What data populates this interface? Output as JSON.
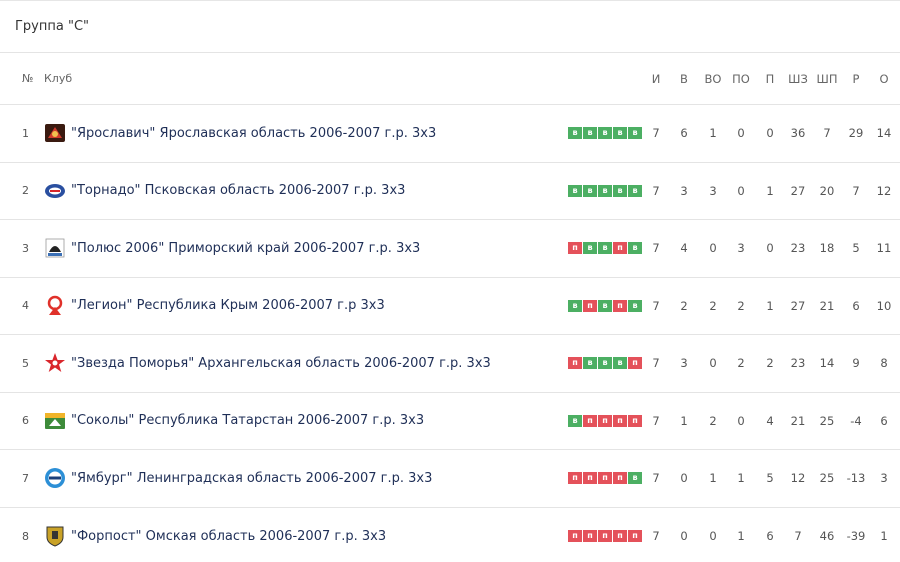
{
  "group_title": "Группа \"С\"",
  "headers": {
    "num": "№",
    "club": "Клуб",
    "i": "И",
    "v": "В",
    "vo": "ВО",
    "po": "ПО",
    "p": "П",
    "sz": "ШЗ",
    "sp": "ШП",
    "r": "Р",
    "o": "О"
  },
  "rows": [
    {
      "num": "1",
      "name": "\"Ярославич\" Ярославская область 2006-2007 г.р. 3х3",
      "logo": "yaroslavich-logo",
      "logo_color": "#d23b2c",
      "form": [
        "в",
        "в",
        "в",
        "в",
        "в"
      ],
      "i": "7",
      "v": "6",
      "vo": "1",
      "po": "0",
      "p": "0",
      "sz": "36",
      "sp": "7",
      "r": "29",
      "o": "14"
    },
    {
      "num": "2",
      "name": "\"Торнадо\" Псковская область 2006-2007 г.р. 3х3",
      "logo": "tornado-logo",
      "logo_color": "#2a4fa0",
      "form": [
        "в",
        "в",
        "в",
        "в",
        "в"
      ],
      "i": "7",
      "v": "3",
      "vo": "3",
      "po": "0",
      "p": "1",
      "sz": "27",
      "sp": "20",
      "r": "7",
      "o": "12"
    },
    {
      "num": "3",
      "name": "\"Полюс 2006\" Приморский край 2006-2007 г.р. 3х3",
      "logo": "polyus-logo",
      "logo_color": "#222222",
      "form": [
        "п",
        "в",
        "в",
        "п",
        "в"
      ],
      "i": "7",
      "v": "4",
      "vo": "0",
      "po": "3",
      "p": "0",
      "sz": "23",
      "sp": "18",
      "r": "5",
      "o": "11"
    },
    {
      "num": "4",
      "name": "\"Легион\" Республика Крым 2006-2007 г.р 3х3",
      "logo": "legion-logo",
      "logo_color": "#e0312a",
      "form": [
        "в",
        "п",
        "в",
        "п",
        "в"
      ],
      "i": "7",
      "v": "2",
      "vo": "2",
      "po": "2",
      "p": "1",
      "sz": "27",
      "sp": "21",
      "r": "6",
      "o": "10"
    },
    {
      "num": "5",
      "name": "\"Звезда Поморья\" Архангельская область 2006-2007 г.р. 3х3",
      "logo": "zvezda-logo",
      "logo_color": "#d9262c",
      "form": [
        "п",
        "в",
        "в",
        "в",
        "п"
      ],
      "i": "7",
      "v": "3",
      "vo": "0",
      "po": "2",
      "p": "2",
      "sz": "23",
      "sp": "14",
      "r": "9",
      "o": "8"
    },
    {
      "num": "6",
      "name": "\"Соколы\" Республика Татарстан 2006-2007 г.р. 3х3",
      "logo": "sokoly-logo",
      "logo_color": "#3d8b3a",
      "form": [
        "в",
        "п",
        "п",
        "п",
        "п"
      ],
      "i": "7",
      "v": "1",
      "vo": "2",
      "po": "0",
      "p": "4",
      "sz": "21",
      "sp": "25",
      "r": "-4",
      "o": "6"
    },
    {
      "num": "7",
      "name": "\"Ямбург\" Ленинградская область 2006-2007 г.р. 3х3",
      "logo": "yamburg-logo",
      "logo_color": "#2c8fd6",
      "form": [
        "п",
        "п",
        "п",
        "п",
        "в"
      ],
      "i": "7",
      "v": "0",
      "vo": "1",
      "po": "1",
      "p": "5",
      "sz": "12",
      "sp": "25",
      "r": "-13",
      "o": "3"
    },
    {
      "num": "8",
      "name": "\"Форпост\" Омская область 2006-2007 г.р. 3х3",
      "logo": "forpost-logo",
      "logo_color": "#c9a227",
      "form": [
        "п",
        "п",
        "п",
        "п",
        "п"
      ],
      "i": "7",
      "v": "0",
      "vo": "0",
      "po": "1",
      "p": "6",
      "sz": "7",
      "sp": "46",
      "r": "-39",
      "o": "1"
    }
  ]
}
